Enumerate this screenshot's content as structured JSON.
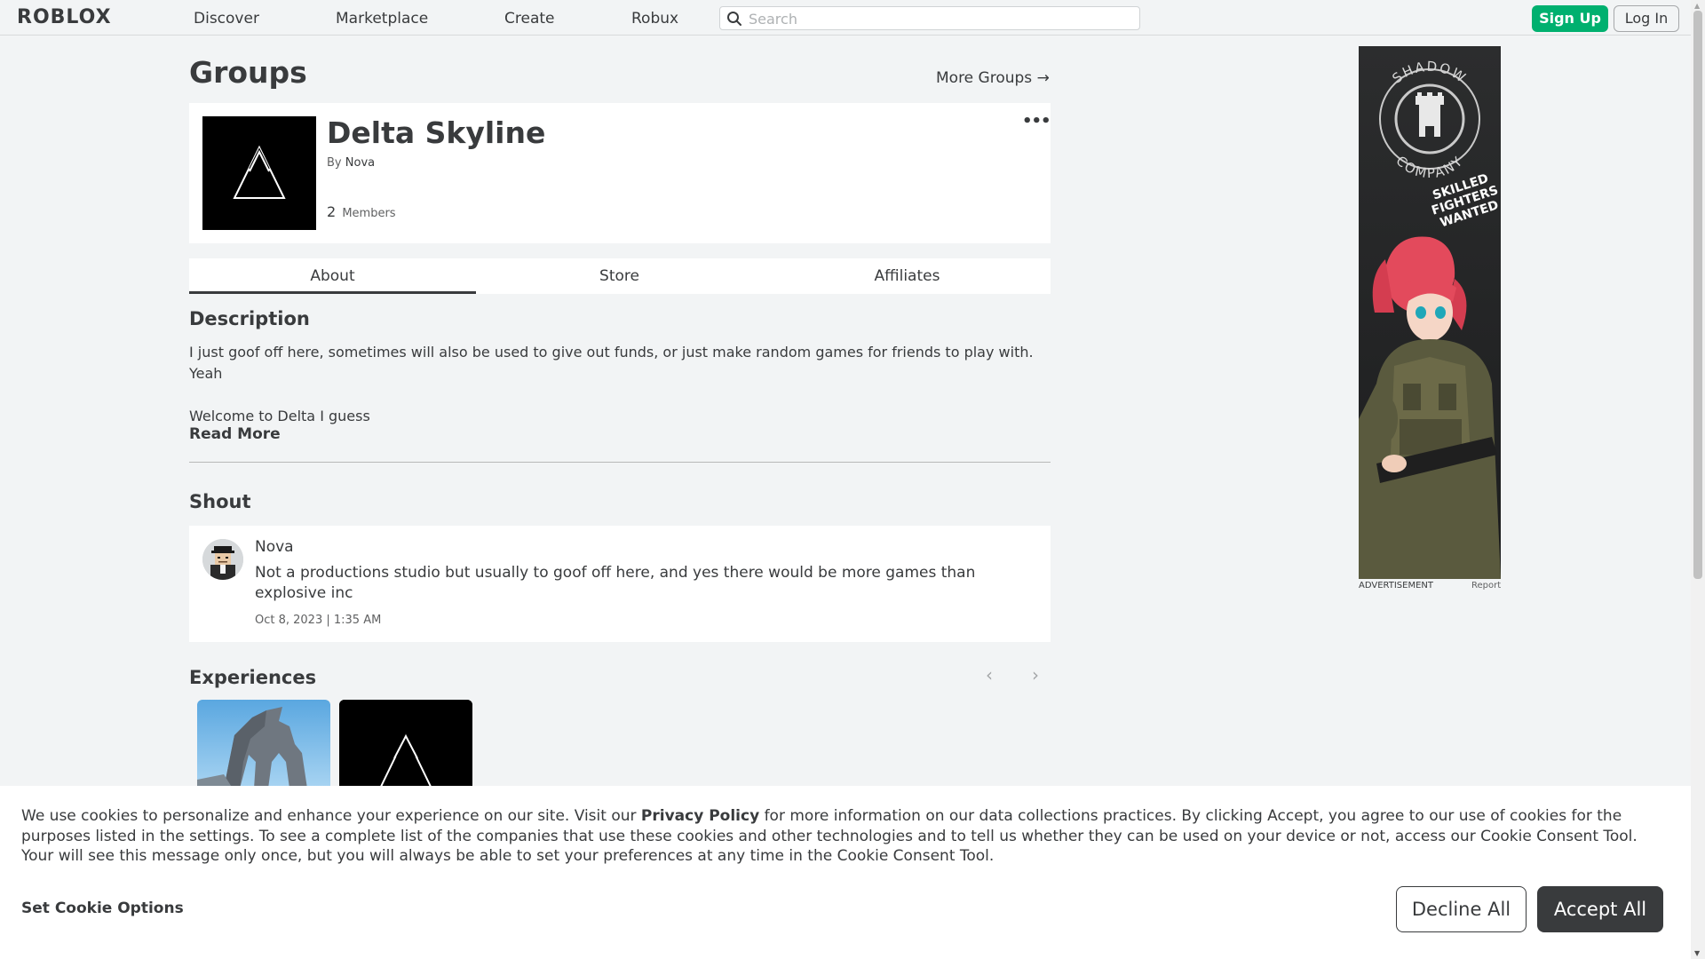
{
  "nav": {
    "logo": "ROBLOX",
    "links": [
      "Discover",
      "Marketplace",
      "Create",
      "Robux"
    ],
    "search_placeholder": "Search",
    "signup_label": "Sign Up",
    "login_label": "Log In"
  },
  "page": {
    "title": "Groups",
    "more_groups_label": "More Groups →"
  },
  "group": {
    "name": "Delta Skyline",
    "by_prefix": "By",
    "owner": "Nova",
    "member_count": "2",
    "members_label": "Members",
    "menu_glyph": "•••"
  },
  "tabs": [
    "About",
    "Store",
    "Affiliates"
  ],
  "description": {
    "title": "Description",
    "line1": "I just goof off here, sometimes will also be used to give out funds, or just make random games for friends to play with. Yeah",
    "line2": "Welcome to Delta I guess",
    "read_more": "Read More"
  },
  "shout": {
    "title": "Shout",
    "author": "Nova",
    "text": "Not a productions studio but usually to goof off here, and yes there would be more games than explosive inc",
    "date": "Oct 8, 2023 | 1:35 AM"
  },
  "experiences": {
    "title": "Experiences",
    "prev_glyph": "‹",
    "next_glyph": "›"
  },
  "ad": {
    "ring_top": "SHADOW",
    "ring_bottom": "COMPANY",
    "tagline1": "SKILLED",
    "tagline2": "FIGHTERS",
    "tagline3": "WANTED",
    "label": "ADVERTISEMENT",
    "report": "Report"
  },
  "cookie": {
    "text_before": "We use cookies to personalize and enhance your experience on our site. Visit our ",
    "privacy_link": "Privacy Policy",
    "text_after": " for more information on our data collections practices. By clicking Accept, you agree to our use of cookies for the purposes listed in the settings. To see a complete list of the companies that use these cookies and other technologies and to tell us whether they can be used on your device or not, access our Cookie Consent Tool. Your will see this message only once, but you will always be able to set your preferences at any time in the Cookie Consent Tool.",
    "options_label": "Set Cookie Options",
    "decline_label": "Decline All",
    "accept_label": "Accept All"
  },
  "colors": {
    "accent_green": "#00b06f",
    "text_primary": "#393b3d",
    "background": "#f2f4f5"
  }
}
